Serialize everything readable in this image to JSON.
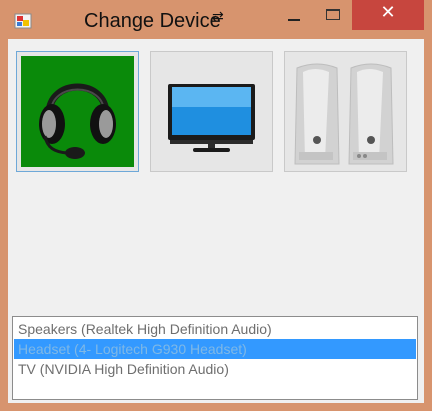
{
  "window": {
    "title": "Change Device",
    "move_glyph": "⇄",
    "close_glyph": "✕",
    "colors": {
      "frame": "#d7946e",
      "close": "#c7463e",
      "client": "#f0f0f0",
      "selection": "#3399ff"
    }
  },
  "devices": {
    "tiles": [
      {
        "icon": "headset-icon",
        "selected": true
      },
      {
        "icon": "tv-icon",
        "selected": false
      },
      {
        "icon": "speakers-icon",
        "selected": false
      }
    ],
    "list": [
      {
        "label": "Speakers (Realtek High Definition Audio)",
        "selected": false
      },
      {
        "label": "Headset (4- Logitech G930 Headset)",
        "selected": true
      },
      {
        "label": "TV (NVIDIA High Definition Audio)",
        "selected": false
      }
    ]
  }
}
